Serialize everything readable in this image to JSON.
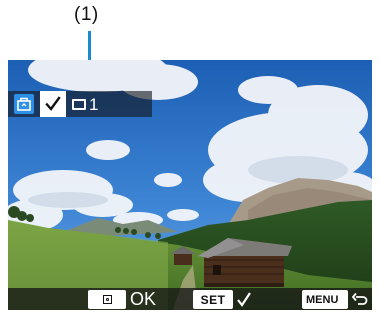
{
  "callout": {
    "label": "(1)"
  },
  "info_bar": {
    "check_mark": "✓",
    "image_count": "1",
    "icons": [
      "protect-icon",
      "check-icon",
      "image-frame-icon"
    ]
  },
  "bottom_bar": {
    "ok_label": "OK",
    "set_label": "SET",
    "set_check": "✓",
    "menu_label": "MENU",
    "icons": [
      "magnify-icon",
      "check-icon",
      "return-arrow-icon"
    ]
  },
  "colors": {
    "accent_blue": "#2e8fe6",
    "leader_line": "#1c8ad0",
    "overlay_dark": "#16181e"
  }
}
